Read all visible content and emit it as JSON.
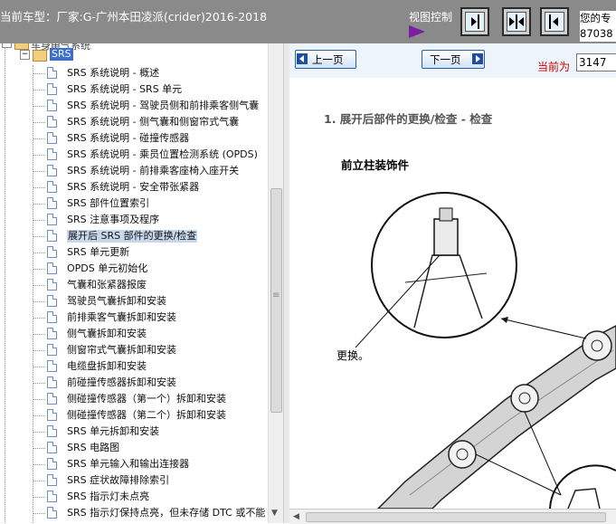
{
  "header": {
    "car_model": "当前车型：厂家:G-广州本田凌派(crider)2016-2018",
    "view_control": "视图控制",
    "user_line1": "您的专",
    "user_line2": "87038"
  },
  "tree": {
    "root_label": "车身电气系统",
    "srs_label": "SRS",
    "items": [
      "SRS 系统说明 - 概述",
      "SRS 系统说明 - SRS 单元",
      "SRS 系统说明 - 驾驶员侧和前排乘客侧气囊",
      "SRS 系统说明 - 侧气囊和侧窗帘式气囊",
      "SRS 系统说明 - 碰撞传感器",
      "SRS 系统说明 - 乘员位置检测系统 (OPDS)",
      "SRS 系统说明 - 前排乘客座椅入座开关",
      "SRS 系统说明 - 安全带张紧器",
      "SRS 部件位置索引",
      "SRS 注意事项及程序",
      "展开后 SRS 部件的更换/检查",
      "SRS 单元更新",
      "OPDS 单元初始化",
      "气囊和张紧器报废",
      "驾驶员气囊拆卸和安装",
      "前排乘客气囊拆卸和安装",
      "侧气囊拆卸和安装",
      "侧窗帘式气囊拆卸和安装",
      "电缆盘拆卸和安装",
      "前碰撞传感器拆卸和安装",
      "侧碰撞传感器（第一个）拆卸和安装",
      "侧碰撞传感器（第二个）拆卸和安装",
      "SRS 单元拆卸和安装",
      "SRS 电路图",
      "SRS 单元输入和输出连接器",
      "SRS 症状故障排除索引",
      "SRS 指示灯未点亮",
      "SRS 指示灯保持点亮，但未存储 DTC 或不能"
    ],
    "selected_index": 10
  },
  "nav": {
    "prev_label": "上一页",
    "next_label": "下一页",
    "current_label": "当前为",
    "page_number": "3147"
  },
  "content": {
    "heading": "1. 展开后部件的更换/检查 - 检查",
    "subheading": "前立柱装饰件",
    "callout": "更换。"
  },
  "colors": {
    "header_bg": "#8a8a8a",
    "selection_bg": "#3a6fd0",
    "current_label": "#d10000",
    "view_arrow": "#7b1fa2"
  }
}
